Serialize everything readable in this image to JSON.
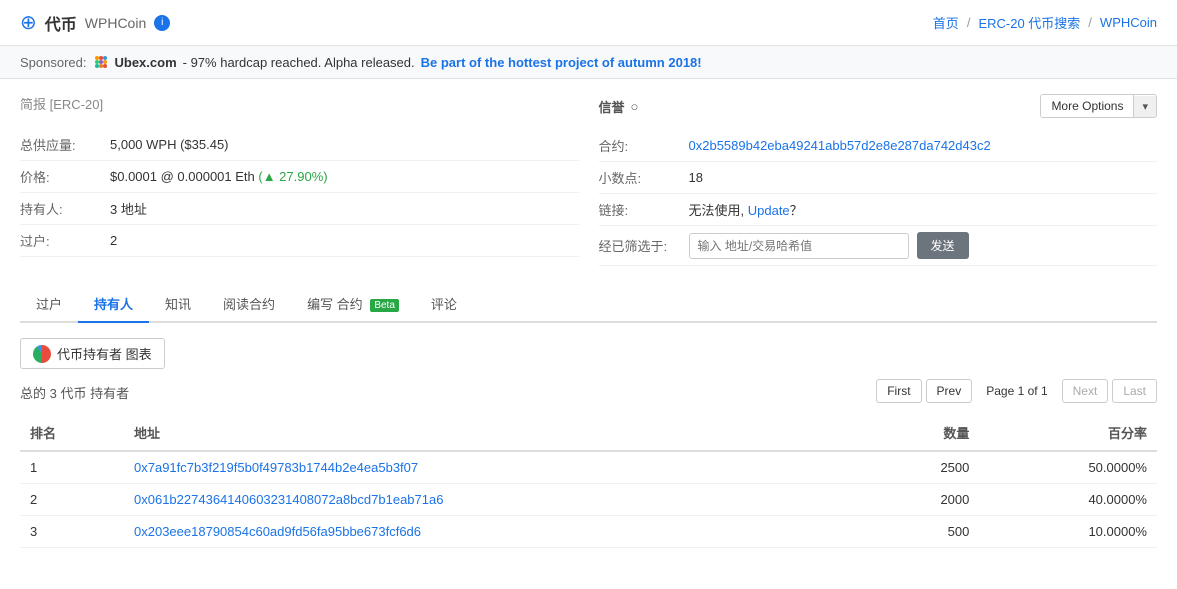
{
  "header": {
    "logo_icon": "⊕",
    "logo_text": "代币",
    "logo_sub": "WPHCoin",
    "info_icon": "i",
    "breadcrumb": {
      "home": "首页",
      "sep1": "/",
      "search": "ERC-20 代币搜索",
      "sep2": "/",
      "current": "WPHCoin"
    }
  },
  "sponsored": {
    "label": "Sponsored:",
    "site_name": "Ubex.com",
    "description": " - 97% hardcap reached. Alpha released. ",
    "link_text": "Be part of the hottest project of autumn 2018!",
    "link_href": "#"
  },
  "left_panel": {
    "title": "简报",
    "title_badge": "[ERC-20]",
    "rows": [
      {
        "label": "总供应量:",
        "value": "5,000 WPH ($35.45)"
      },
      {
        "label": "价格:",
        "value": "$0.0001 @ 0.000001 Eth (▲ 27.90%)"
      },
      {
        "label": "持有人:",
        "value": "3 地址"
      },
      {
        "label": "过户:",
        "value": "2"
      }
    ]
  },
  "right_panel": {
    "title": "信誉",
    "more_options_label": "More Options",
    "rows": [
      {
        "label": "合约:",
        "value": "0x2b5589b42eba49241abb57d2e8e287da742d43c2",
        "is_link": true
      },
      {
        "label": "小数点:",
        "value": "18",
        "is_link": false
      },
      {
        "label": "链接:",
        "value": "无法使用, ",
        "link_text": "Update",
        "suffix": "？",
        "is_link": true
      },
      {
        "label": "经已筛选于:",
        "value": null,
        "is_filter": true
      }
    ],
    "filter_placeholder": "输入 地址/交易哈希值",
    "filter_btn": "发送"
  },
  "tabs": [
    {
      "label": "过户",
      "active": false
    },
    {
      "label": "持有人",
      "active": true
    },
    {
      "label": "知讯",
      "active": false
    },
    {
      "label": "阅读合约",
      "active": false
    },
    {
      "label": "编写 合约",
      "active": false,
      "badge": "Beta"
    },
    {
      "label": "评论",
      "active": false
    }
  ],
  "holders": {
    "chart_btn": "代币持有者 图表",
    "summary": "总的 3 代币 持有者",
    "pagination": {
      "first": "First",
      "prev": "Prev",
      "page_info": "Page 1 of 1",
      "next": "Next",
      "last": "Last"
    },
    "columns": [
      "排名",
      "地址",
      "数量",
      "百分率"
    ],
    "rows": [
      {
        "rank": "1",
        "address": "0x7a91fc7b3f219f5b0f49783b1744b2e4ea5b3f07",
        "amount": "2500",
        "percent": "50.0000%"
      },
      {
        "rank": "2",
        "address": "0x061b2274364140603231408072a8bcd7b1eab71a6",
        "amount": "2000",
        "percent": "40.0000%"
      },
      {
        "rank": "3",
        "address": "0x203eee18790854c60ad9fd56fa95bbe673fcf6d6",
        "amount": "500",
        "percent": "10.0000%"
      }
    ]
  }
}
